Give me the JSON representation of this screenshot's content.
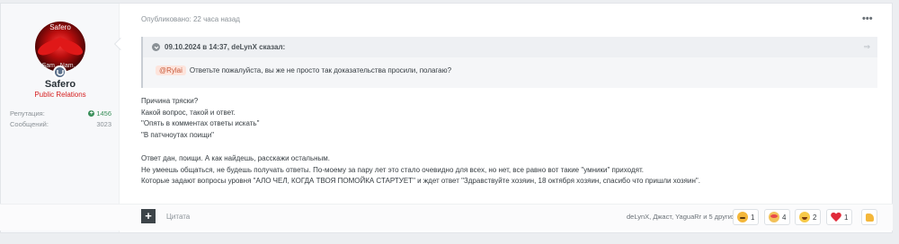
{
  "author": {
    "avatar_caption_top": "Safero",
    "avatar_caption_bottom": "Sam...Nam...",
    "name": "Safero",
    "group": "Public Relations",
    "group_color": "#d62020",
    "stats": [
      {
        "label": "Репутация:",
        "value": "1456"
      },
      {
        "label": "Сообщений:",
        "value": "3023"
      }
    ]
  },
  "post": {
    "published": "Опубликовано: 22 часа назад",
    "menu_icon": "ellipsis-icon",
    "quote": {
      "header": "09.10.2024 в 14:37, deLynX сказал:",
      "mention": "@Rylai",
      "text": "Ответьте пожалуйста, вы же не просто так доказательства просили, полагаю?"
    },
    "paragraph1": [
      "Причина тряски?",
      "Какой вопрос, такой и ответ.",
      "\"Опять в комментах ответы искать\"",
      "\"В патчноутах поищи\""
    ],
    "paragraph2": [
      "Ответ дан, поищи. А как найдешь, расскажи остальным.",
      "Не умеешь общаться, не будешь получать ответы. По-моему за пару лет это стало очевидно для всех, но нет, все равно вот такие \"умники\" приходят.",
      "Которые задают вопросы уровня \"АЛО ЧЕЛ, КОГДА ТВОЯ ПОМОЙКА СТАРТУЕТ\" и ждет ответ \"Здравствуйте хозяин, 18 октября хозяин, спасибо что пришли хозяин\"."
    ]
  },
  "footer": {
    "quote_button": "+",
    "quote_label": "Цитата",
    "reactors": "deLynX, Джаст, YaguaRr и 5 других",
    "reactions": [
      {
        "icon": "facepalm-emoji-icon",
        "count": "1"
      },
      {
        "icon": "clown-emoji-icon",
        "count": "4"
      },
      {
        "icon": "laugh-emoji-icon",
        "count": "2"
      },
      {
        "icon": "heart-icon",
        "count": "1"
      }
    ],
    "like_icon": "thumbs-up-icon"
  }
}
